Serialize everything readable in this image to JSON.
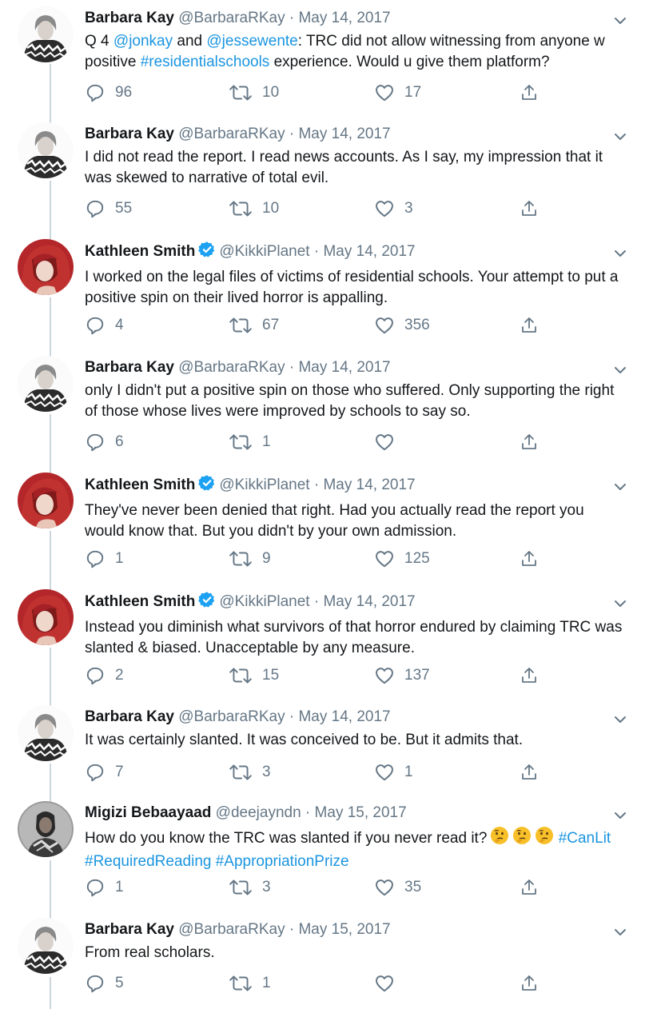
{
  "tweets": [
    {
      "author": "Barbara Kay",
      "handle": "@BarbaraRKay",
      "date": "May 14, 2017",
      "verified": false,
      "avatar": "barbara",
      "segments": [
        {
          "t": "Q 4 ",
          "link": false
        },
        {
          "t": "@jonkay",
          "link": true
        },
        {
          "t": " and ",
          "link": false
        },
        {
          "t": "@jessewente",
          "link": true
        },
        {
          "t": ": TRC did not allow witnessing from anyone w positive ",
          "link": false
        },
        {
          "t": "#residentialschools",
          "link": true
        },
        {
          "t": " experience. Would u give them platform?",
          "link": false
        }
      ],
      "replies": "96",
      "retweets": "10",
      "likes": "17"
    },
    {
      "author": "Barbara Kay",
      "handle": "@BarbaraRKay",
      "date": "May 14, 2017",
      "verified": false,
      "avatar": "barbara",
      "segments": [
        {
          "t": "I did not read the report. I read news accounts. As I say, my impression that it was skewed to narrative of total evil.",
          "link": false
        }
      ],
      "replies": "55",
      "retweets": "10",
      "likes": "3"
    },
    {
      "author": "Kathleen Smith",
      "handle": "@KikkiPlanet",
      "date": "May 14, 2017",
      "verified": true,
      "avatar": "kathleen",
      "segments": [
        {
          "t": "I worked on the legal files of victims of residential schools. Your attempt to put a positive spin on their lived horror is appalling.",
          "link": false
        }
      ],
      "replies": "4",
      "retweets": "67",
      "likes": "356"
    },
    {
      "author": "Barbara Kay",
      "handle": "@BarbaraRKay",
      "date": "May 14, 2017",
      "verified": false,
      "avatar": "barbara",
      "segments": [
        {
          "t": "only I didn't put a positive spin on those who suffered. Only supporting the right of those whose lives were improved by schools to say so.",
          "link": false
        }
      ],
      "replies": "6",
      "retweets": "1",
      "likes": ""
    },
    {
      "author": "Kathleen Smith",
      "handle": "@KikkiPlanet",
      "date": "May 14, 2017",
      "verified": true,
      "avatar": "kathleen",
      "segments": [
        {
          "t": "They've never been denied that right. Had you actually read the report you would know that. But you didn't by your own admission.",
          "link": false
        }
      ],
      "replies": "1",
      "retweets": "9",
      "likes": "125"
    },
    {
      "author": "Kathleen Smith",
      "handle": "@KikkiPlanet",
      "date": "May 14, 2017",
      "verified": true,
      "avatar": "kathleen",
      "segments": [
        {
          "t": "Instead you diminish what survivors of that horror endured by claiming TRC was slanted & biased. Unacceptable by any measure.",
          "link": false
        }
      ],
      "replies": "2",
      "retweets": "15",
      "likes": "137"
    },
    {
      "author": "Barbara Kay",
      "handle": "@BarbaraRKay",
      "date": "May 14, 2017",
      "verified": false,
      "avatar": "barbara",
      "segments": [
        {
          "t": "It was certainly slanted. It was conceived to be. But it admits that.",
          "link": false
        }
      ],
      "replies": "7",
      "retweets": "3",
      "likes": "1"
    },
    {
      "author": "Migizi Bebaayaad",
      "handle": "@deejayndn",
      "date": "May 15, 2017",
      "verified": false,
      "avatar": "migizi",
      "segments": [
        {
          "t": "How do you know the TRC was slanted if you never read it?",
          "link": false
        },
        {
          "t": "",
          "link": false,
          "emoji": "thinking-face",
          "count": 3
        },
        {
          "t": " ",
          "link": false
        },
        {
          "t": "#CanLit #RequiredReading #AppropriationPrize",
          "link": true
        }
      ],
      "replies": "1",
      "retweets": "3",
      "likes": "35"
    },
    {
      "author": "Barbara Kay",
      "handle": "@BarbaraRKay",
      "date": "May 15, 2017",
      "verified": false,
      "avatar": "barbara",
      "segments": [
        {
          "t": "From real scholars.",
          "link": false
        }
      ],
      "replies": "5",
      "retweets": "1",
      "likes": ""
    }
  ],
  "separator": " · ",
  "colors": {
    "link": "#1b95e0",
    "secondary": "#657786",
    "thread_line": "#ccd6dd",
    "verified": "#1da1f2"
  },
  "icons": {
    "reply": "reply-icon",
    "retweet": "retweet-icon",
    "like": "heart-icon",
    "share": "share-icon",
    "menu": "chevron-down-icon",
    "verified": "verified-badge-icon",
    "emoji": "thinking-face-emoji"
  }
}
